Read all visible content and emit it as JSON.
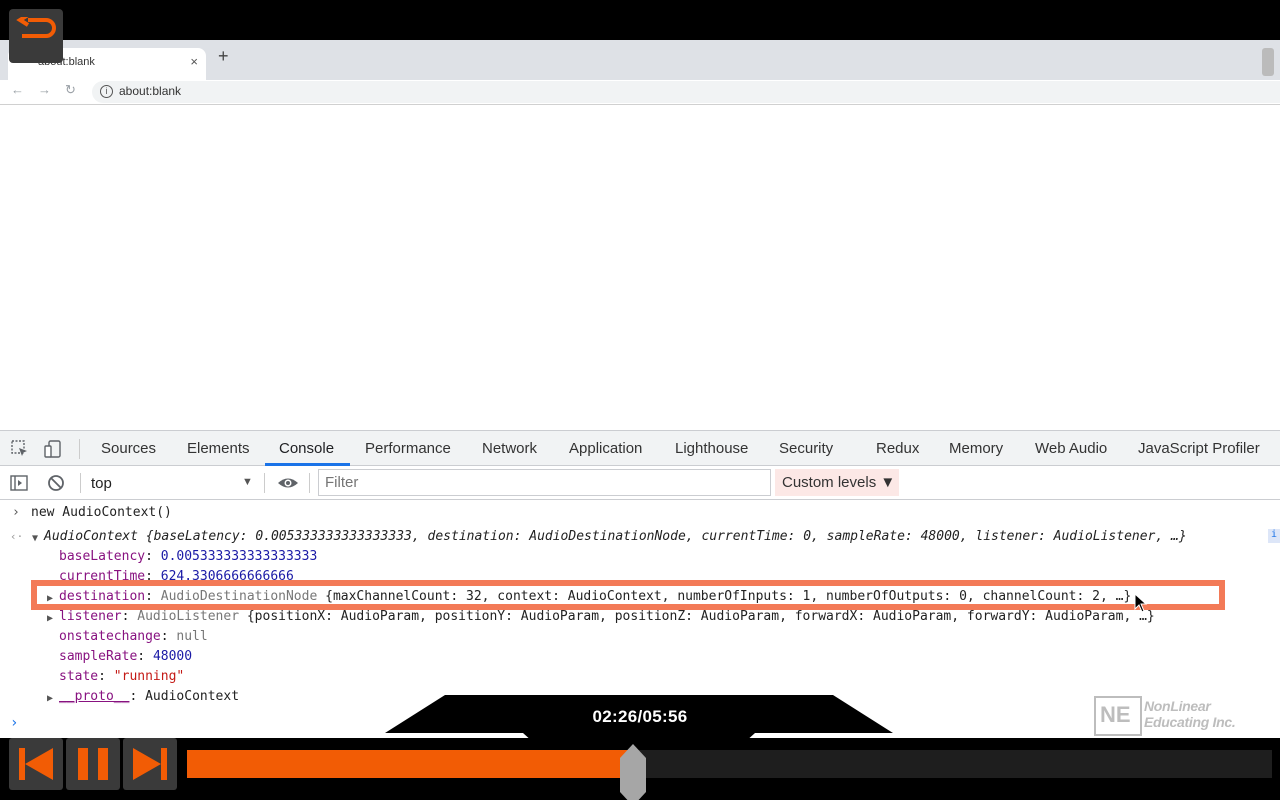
{
  "browser": {
    "tab_title": "about:blank",
    "tab_close": "×",
    "new_tab": "+",
    "url": "about:blank",
    "info": "i"
  },
  "devtools": {
    "tabs": [
      "Sources",
      "Elements",
      "Console",
      "Performance",
      "Network",
      "Application",
      "Lighthouse",
      "Security",
      "Redux",
      "Memory",
      "Web Audio",
      "JavaScript Profiler"
    ],
    "active_tab": "Console",
    "context": "top",
    "filter_placeholder": "Filter",
    "levels": "Custom levels ▼"
  },
  "console": {
    "input": "new AudioContext()",
    "summary_name": "AudioContext",
    "summary_rest": " {baseLatency: 0.005333333333333333, destination: AudioDestinationNode, currentTime: 0, sampleRate: 48000, listener: AudioListener, …}",
    "props": {
      "baseLatency_key": "baseLatency",
      "baseLatency_val": "0.005333333333333333",
      "currentTime_key": "currentTime",
      "currentTime_val": "624.3306666666666",
      "destination_key": "destination",
      "destination_type": "AudioDestinationNode",
      "destination_val": " {maxChannelCount: 32, context: AudioContext, numberOfInputs: 1, numberOfOutputs: 0, channelCount: 2, …}",
      "listener_key": "listener",
      "listener_type": "AudioListener",
      "listener_val": " {positionX: AudioParam, positionY: AudioParam, positionZ: AudioParam, forwardX: AudioParam, forwardY: AudioParam, …}",
      "onstatechange_key": "onstatechange",
      "onstatechange_val": "null",
      "sampleRate_key": "sampleRate",
      "sampleRate_val": "48000",
      "state_key": "state",
      "state_val": "\"running\"",
      "proto_key": "__proto__",
      "proto_val": "AudioContext"
    },
    "badge": "i"
  },
  "player": {
    "time": "02:26/05:56",
    "progress": 0.411,
    "logo_line1": "NonLinear",
    "logo_line2": "Educating Inc.",
    "logo_mark": "NE",
    "accent": "#f25c05"
  }
}
